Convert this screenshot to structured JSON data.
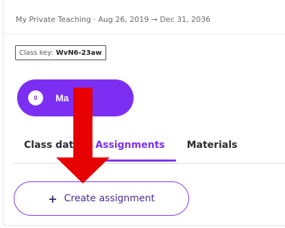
{
  "header": {
    "course_name": "My Private Teaching",
    "date_range": "· Aug 26, 2019 → Dec 31, 2036"
  },
  "class_key": {
    "label": "Class key:",
    "value": "WvN6-23aw"
  },
  "members_button": {
    "count": "0",
    "label": "Ma",
    "chevron": ">"
  },
  "tabs": [
    {
      "label": "Class dat",
      "active": false
    },
    {
      "label": "Assignments",
      "active": true
    },
    {
      "label": "Materials",
      "active": false
    }
  ],
  "create_button": {
    "icon": "plus-icon",
    "label": "Create assignment"
  },
  "colors": {
    "accent": "#7c2ff2",
    "annotation_arrow": "#e60000"
  }
}
